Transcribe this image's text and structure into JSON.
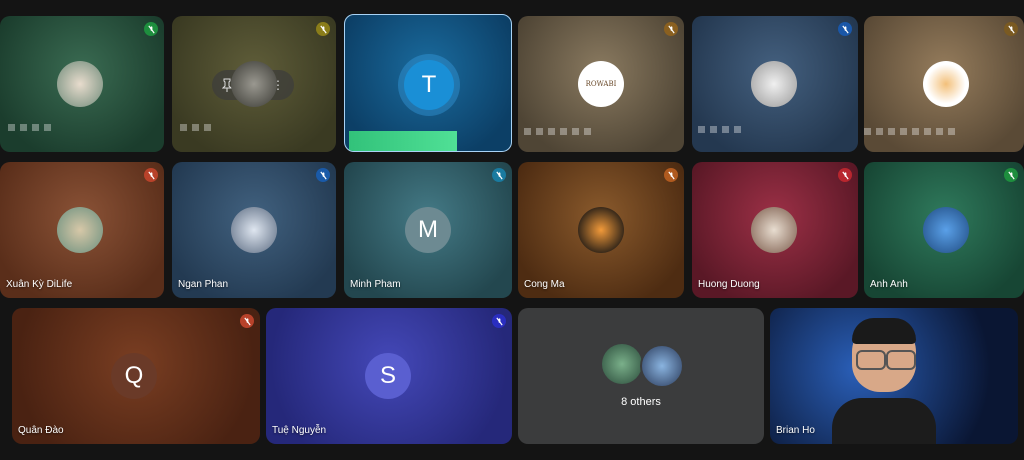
{
  "tiles": [
    {
      "id": "t1",
      "name": "",
      "letter": "",
      "muted": true,
      "mute_color": "#1e8e3e",
      "bg": "#1f4a35",
      "avatar_bg": "#c9b9a6"
    },
    {
      "id": "t2",
      "name": "",
      "letter": "",
      "muted": true,
      "mute_color": "#8a7d1a",
      "bg": "#4b4a2a",
      "avatar_bg": "#6b6a64"
    },
    {
      "id": "t3",
      "name": "",
      "letter": "T",
      "muted": false,
      "bg": "#0b4f7d",
      "avatar_bg": "#1a8fd6"
    },
    {
      "id": "t4",
      "name": "",
      "letter": "",
      "muted": true,
      "mute_color": "#8a6020",
      "bg": "#665b49",
      "avatar_bg": "#ffffff",
      "avatar_text": "ROWABI"
    },
    {
      "id": "t5",
      "name": "",
      "letter": "",
      "muted": true,
      "mute_color": "#1a57a8",
      "bg": "#2e4664",
      "avatar_bg": "#d9d9d9"
    },
    {
      "id": "t6",
      "name": "",
      "letter": "",
      "muted": true,
      "mute_color": "#7a5a22",
      "bg": "#6e5b44",
      "avatar_bg": "#ffffff"
    },
    {
      "id": "t7",
      "name": "Xuân Kỳ DiLife",
      "letter": "",
      "muted": true,
      "mute_color": "#b8422a",
      "bg": "#6d3a22",
      "avatar_bg": "#8fb0a0"
    },
    {
      "id": "t8",
      "name": "Ngan Phan",
      "letter": "",
      "muted": true,
      "mute_color": "#1a5aa8",
      "bg": "#2a4762",
      "avatar_bg": "#b9c7d9"
    },
    {
      "id": "t9",
      "name": "Minh Pham",
      "letter": "M",
      "muted": true,
      "mute_color": "#1a7ba0",
      "bg": "#2d5661",
      "avatar_bg": "#6d8a92"
    },
    {
      "id": "t10",
      "name": "Cong Ma",
      "letter": "",
      "muted": true,
      "mute_color": "#b05a1f",
      "bg": "#61381b",
      "avatar_bg": "#6a4a2a"
    },
    {
      "id": "t11",
      "name": "Huong Duong",
      "letter": "",
      "muted": true,
      "mute_color": "#b8262e",
      "bg": "#6e2230",
      "avatar_bg": "#e0d6cc"
    },
    {
      "id": "t12",
      "name": "Anh Anh",
      "letter": "",
      "muted": true,
      "mute_color": "#1e8e3e",
      "bg": "#1f5a44",
      "avatar_bg": "#2a6fb0"
    },
    {
      "id": "t13",
      "name": "Quân Đào",
      "letter": "Q",
      "muted": true,
      "mute_color": "#b8422a",
      "bg": "#5b2e1c",
      "avatar_bg": "#6a3a28"
    },
    {
      "id": "t14",
      "name": "Tuệ Nguyễn",
      "letter": "S",
      "muted": true,
      "mute_color": "#2a2ec0",
      "bg": "#2c2f82",
      "avatar_bg": "#5a5fd0"
    },
    {
      "id": "t15",
      "name": "",
      "others_label": "8 others",
      "bg": "#3b3b3b"
    },
    {
      "id": "t16",
      "name": "Brian Ho",
      "bg": "#0c1530"
    }
  ]
}
